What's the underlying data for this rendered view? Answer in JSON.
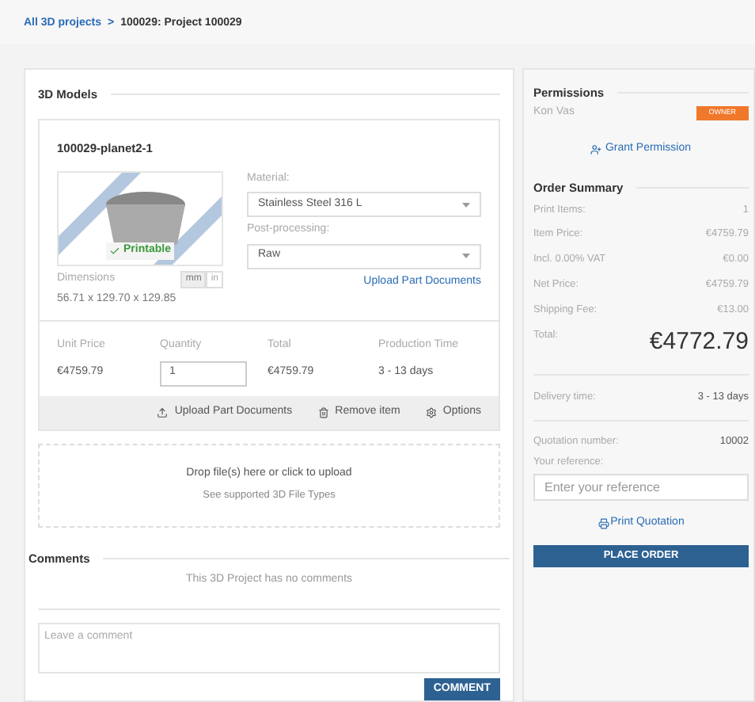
{
  "breadcrumb": {
    "link": "All 3D projects",
    "separator": ">",
    "current": "100029: Project 100029"
  },
  "models": {
    "title": "3D Models",
    "item": {
      "name": "100029-planet2-1",
      "printable": true,
      "printable_label": "Printable",
      "dimensions_label": "Dimensions",
      "units": [
        {
          "label": "mm",
          "selected": true
        },
        {
          "label": "in",
          "selected": false
        }
      ],
      "dimensions": "56.71 x 129.70 x 129.85",
      "material_label": "Material:",
      "material": "Stainless Steel 316 L",
      "post_label": "Post-processing:",
      "post": "Raw",
      "upload_link": "Upload Part Documents",
      "price_headers": [
        "Unit Price",
        "Quantity",
        "Total",
        "Production Time"
      ],
      "unit_price": "€4759.79",
      "quantity": "1",
      "total": "€4759.79",
      "production_time": "3 - 13 days",
      "actions": [
        {
          "kind": "upload",
          "label": "Upload Part Documents"
        },
        {
          "kind": "remove",
          "label": "Remove item"
        },
        {
          "kind": "options",
          "label": "Options"
        }
      ]
    },
    "dropzone": {
      "title": "Drop file(s) here or click to upload",
      "link": "See supported 3D File Types"
    }
  },
  "comments": {
    "title": "Comments",
    "empty": "This 3D Project has no comments",
    "placeholder": "Leave a comment",
    "button": "COMMENT"
  },
  "permissions": {
    "title": "Permissions",
    "user": "Kon Vas",
    "role": "OWNER",
    "grant": "Grant Permission"
  },
  "summary": {
    "title": "Order Summary",
    "rows": [
      {
        "label": "Print Items:",
        "value": "1"
      },
      {
        "label": "Item Price:",
        "value": "€4759.79"
      },
      {
        "label": "Incl. 0.00% VAT",
        "value": "€0.00"
      },
      {
        "label": "Net Price:",
        "value": "€4759.79"
      },
      {
        "label": "Shipping Fee:",
        "value": "€13.00"
      }
    ],
    "total_label": "Total:",
    "total": "€4772.79",
    "delivery_label": "Delivery time:",
    "delivery": "3 - 13 days",
    "quotation_label": "Quotation number:",
    "quotation": "10002",
    "reference_label": "Your reference:",
    "reference_placeholder": "Enter your reference",
    "print": "Print Quotation",
    "order": "PLACE ORDER"
  }
}
